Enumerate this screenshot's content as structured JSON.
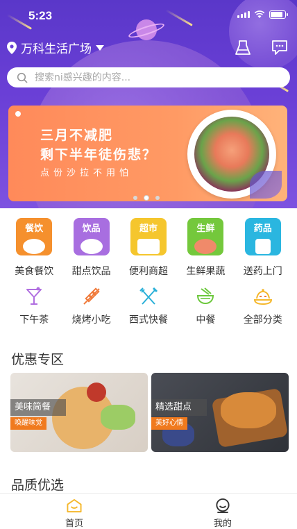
{
  "status_bar": {
    "time": "5:23"
  },
  "header": {
    "location": "万科生活广场",
    "search_placeholder": "搜索ni感兴趣的内容..."
  },
  "banner": {
    "line1": "三月不减肥",
    "line2": "剩下半年徒伤悲？",
    "subtitle": "点份沙拉不用怕",
    "page_count": 3,
    "active_page": 1
  },
  "categories_primary": [
    {
      "tag": "餐饮",
      "label": "美食餐饮",
      "color": "#f5902d"
    },
    {
      "tag": "饮品",
      "label": "甜点饮品",
      "color": "#a86ee0"
    },
    {
      "tag": "超市",
      "label": "便利商超",
      "color": "#f5c62d"
    },
    {
      "tag": "生鲜",
      "label": "生鲜果蔬",
      "color": "#74c83c"
    },
    {
      "tag": "药品",
      "label": "送药上门",
      "color": "#2ab6e0"
    }
  ],
  "categories_secondary": [
    {
      "label": "下午茶",
      "icon": "cocktail-icon",
      "color": "#b06ee0"
    },
    {
      "label": "烧烤小吃",
      "icon": "skewer-icon",
      "color": "#f07a3a"
    },
    {
      "label": "西式快餐",
      "icon": "fork-knife-icon",
      "color": "#2ab0d8"
    },
    {
      "label": "中餐",
      "icon": "bowl-icon",
      "color": "#6cc83c"
    },
    {
      "label": "全部分类",
      "icon": "dish-icon",
      "color": "#f5b82d"
    }
  ],
  "promo": {
    "title": "优惠专区",
    "cards": [
      {
        "caption": "美味简餐",
        "tag": "唤醒味觉"
      },
      {
        "caption": "精选甜点",
        "tag": "美好心情"
      }
    ]
  },
  "quality": {
    "title": "品质优选"
  },
  "tab_bar": {
    "tabs": [
      {
        "label": "首页",
        "color": "#f5b82d"
      },
      {
        "label": "我的",
        "color": "#333333"
      }
    ]
  }
}
